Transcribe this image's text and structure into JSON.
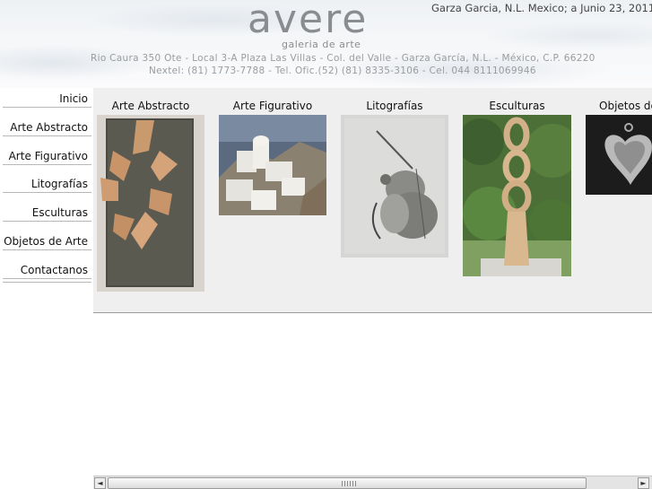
{
  "header": {
    "logo": "avere",
    "logo_subtitle": "galeria de arte",
    "address": "Rio Caura 350 Ote - Local 3-A Plaza Las Villas - Col. del Valle - Garza García, N.L. - México, C.P. 66220",
    "phones": "Nextel: (81) 1773-7788 - Tel. Ofic.(52) (81) 8335-3106 - Cel. 044 8111069946",
    "dateline": "Garza Garcia, N.L. Mexico; a  Junio 23, 2011"
  },
  "sidebar": {
    "items": [
      {
        "label": "Inicio"
      },
      {
        "label": "Arte Abstracto"
      },
      {
        "label": "Arte Figurativo"
      },
      {
        "label": "Litografías"
      },
      {
        "label": "Esculturas"
      },
      {
        "label": "Objetos de Arte"
      },
      {
        "label": "Contactanos"
      }
    ]
  },
  "gallery": {
    "categories": [
      {
        "title": "Arte Abstracto"
      },
      {
        "title": "Arte Figurativo"
      },
      {
        "title": "Litografías"
      },
      {
        "title": "Esculturas"
      },
      {
        "title": "Objetos de"
      }
    ]
  },
  "scrollbar": {
    "left_arrow": "◄",
    "right_arrow": "►"
  },
  "colors": {
    "gallery_bg": "#efefef",
    "text": "#111111",
    "header_text": "#8a8d90"
  }
}
